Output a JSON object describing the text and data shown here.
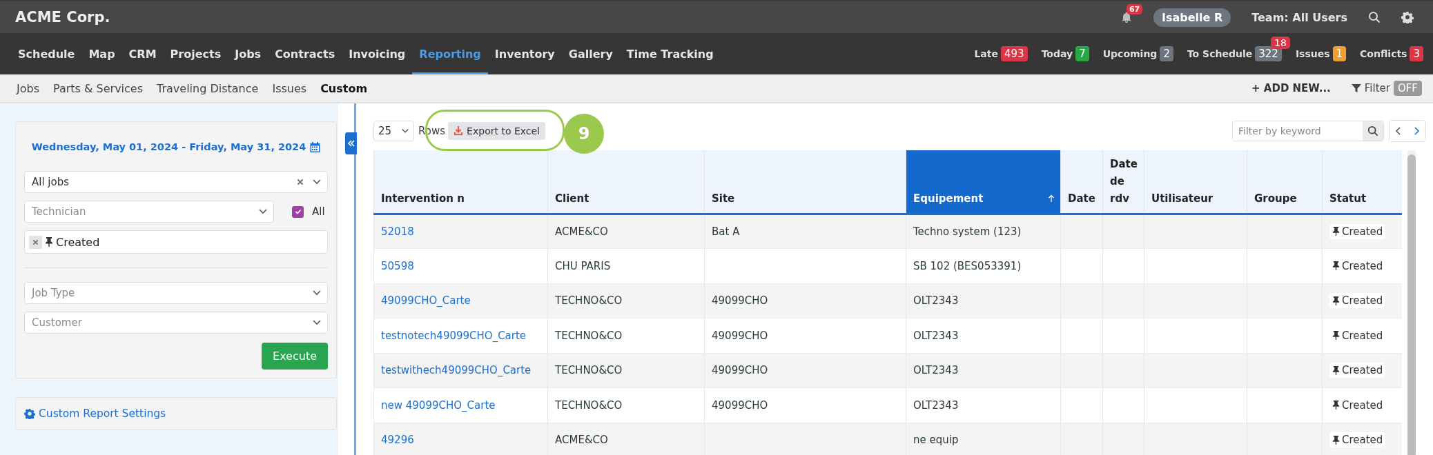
{
  "app": {
    "brand": "ACME Corp.",
    "notifications": "67",
    "user": "Isabelle R",
    "team": "Team: All Users"
  },
  "main_nav": [
    {
      "label": "Schedule",
      "selected": false
    },
    {
      "label": "Map",
      "selected": false
    },
    {
      "label": "CRM",
      "selected": false
    },
    {
      "label": "Projects",
      "selected": false
    },
    {
      "label": "Jobs",
      "selected": false
    },
    {
      "label": "Contracts",
      "selected": false
    },
    {
      "label": "Invoicing",
      "selected": false
    },
    {
      "label": "Reporting",
      "selected": true
    },
    {
      "label": "Inventory",
      "selected": false
    },
    {
      "label": "Gallery",
      "selected": false
    },
    {
      "label": "Time Tracking",
      "selected": false
    }
  ],
  "counters": [
    {
      "label": "Late",
      "count": "493",
      "color": "#dc3545"
    },
    {
      "label": "Today",
      "count": "7",
      "color": "#28a745"
    },
    {
      "label": "Upcoming",
      "count": "2",
      "color": "#6c757d"
    },
    {
      "label": "To Schedule",
      "count": "322",
      "color": "#6c757d",
      "badge": "18"
    },
    {
      "label": "Issues",
      "count": "1",
      "color": "#f0a030"
    },
    {
      "label": "Conflicts",
      "count": "3",
      "color": "#dc3545"
    }
  ],
  "sub_nav": [
    {
      "label": "Jobs",
      "selected": false
    },
    {
      "label": "Parts & Services",
      "selected": false
    },
    {
      "label": "Traveling Distance",
      "selected": false
    },
    {
      "label": "Issues",
      "selected": false
    },
    {
      "label": "Custom",
      "selected": true
    }
  ],
  "actions": {
    "add_new": "+ ADD NEW...",
    "filter": "Filter",
    "filter_toggle": {
      "label": "OFF",
      "on": false
    }
  },
  "filters": {
    "date_range": "Wednesday, May 01, 2024 - Friday, May 31, 2024",
    "job_scope": {
      "value": "All jobs"
    },
    "technician": {
      "placeholder": "Technician"
    },
    "all_checkbox": {
      "label": "All",
      "checked": true
    },
    "status_tags": [
      {
        "label": "Created"
      }
    ],
    "job_type": {
      "placeholder": "Job Type"
    },
    "customer": {
      "placeholder": "Customer"
    },
    "execute": "Execute",
    "settings_link": "Custom Report Settings"
  },
  "table_toolbar": {
    "rows_per_page": "25",
    "rows_label": "Rows",
    "export": "Export to Excel",
    "annotation": "9",
    "search": {
      "placeholder": "Filter by keyword"
    }
  },
  "table": {
    "columns": [
      {
        "label": "Intervention n",
        "sorted": false
      },
      {
        "label": "Client",
        "sorted": false
      },
      {
        "label": "Site",
        "sorted": false
      },
      {
        "label": "Equipement",
        "sorted": true
      },
      {
        "label": "Date",
        "sorted": false
      },
      {
        "label": "Date de rdv",
        "sorted": false
      },
      {
        "label": "Utilisateur",
        "sorted": false
      },
      {
        "label": "Groupe",
        "sorted": false
      },
      {
        "label": "Statut",
        "sorted": false
      }
    ],
    "rows": [
      [
        "52018",
        "ACME&CO",
        "Bat A",
        "Techno system (123)",
        "",
        "",
        "",
        "",
        "Created"
      ],
      [
        "50598",
        "CHU PARIS",
        "",
        "SB 102 (BES053391)",
        "",
        "",
        "",
        "",
        "Created"
      ],
      [
        "49099CHO_Carte",
        "TECHNO&CO",
        "49099CHO",
        "OLT2343",
        "",
        "",
        "",
        "",
        "Created"
      ],
      [
        "testnotech49099CHO_Carte",
        "TECHNO&CO",
        "49099CHO",
        "OLT2343",
        "",
        "",
        "",
        "",
        "Created"
      ],
      [
        "testwithech49099CHO_Carte",
        "TECHNO&CO",
        "49099CHO",
        "OLT2343",
        "",
        "",
        "",
        "",
        "Created"
      ],
      [
        "new 49099CHO_Carte",
        "TECHNO&CO",
        "49099CHO",
        "OLT2343",
        "",
        "",
        "",
        "",
        "Created"
      ],
      [
        "49296",
        "ACME&CO",
        "",
        "ne equip",
        "",
        "",
        "",
        "",
        "Created"
      ]
    ]
  }
}
